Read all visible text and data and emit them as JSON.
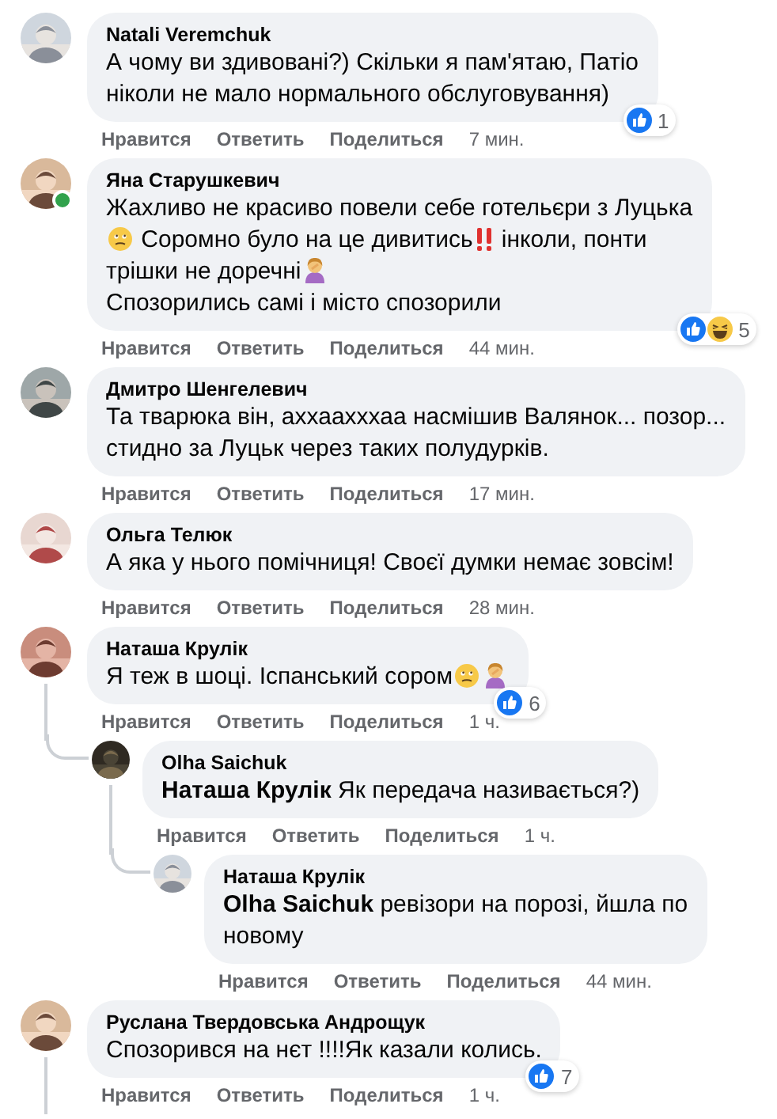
{
  "comments": [
    {
      "name": "Natali Veremchuk",
      "online": false,
      "has_replies": false,
      "body": [
        {
          "kind": "text",
          "text": "А чому ви здивовані?) Скільки я пам'ятаю, Патіо\nніколи не мало нормального обслуговування)"
        }
      ],
      "reactions": {
        "icons": [
          {
            "kind": "like"
          }
        ],
        "count": "1"
      },
      "actions": [
        "Нравится",
        "Ответить",
        "Поделиться"
      ],
      "time": "7 мин."
    },
    {
      "name": "Яна Старушкевич",
      "online": true,
      "has_replies": false,
      "body": [
        {
          "kind": "text",
          "text": "Жахливо не красиво повели себе готельєри з Луцька"
        },
        {
          "kind": "break"
        },
        {
          "kind": "face"
        },
        {
          "kind": "text",
          "text": " Соромно було на це дивитись"
        },
        {
          "kind": "bangs"
        },
        {
          "kind": "text",
          "text": " інколи, понти"
        },
        {
          "kind": "break"
        },
        {
          "kind": "text",
          "text": "трішки не доречні"
        },
        {
          "kind": "person"
        },
        {
          "kind": "break"
        },
        {
          "kind": "text",
          "text": "Спозорились самі і місто спозорили"
        }
      ],
      "reactions": {
        "icons": [
          {
            "kind": "like"
          },
          {
            "kind": "haha"
          }
        ],
        "count": "5"
      },
      "actions": [
        "Нравится",
        "Ответить",
        "Поделиться"
      ],
      "time": "44 мин."
    },
    {
      "name": "Дмитро Шенгелевич",
      "online": false,
      "has_replies": false,
      "body": [
        {
          "kind": "text",
          "text": "Та тварюка він, аххаахххаа насмішив Валянок... позор...\nстидно за Луцьк через таких полудурків."
        }
      ],
      "actions": [
        "Нравится",
        "Ответить",
        "Поделиться"
      ],
      "time": "17 мин."
    },
    {
      "name": "Ольга Телюк",
      "online": false,
      "has_replies": false,
      "body": [
        {
          "kind": "text",
          "text": "А яка у нього помічниця! Своєї думки немає зовсім!"
        }
      ],
      "actions": [
        "Нравится",
        "Ответить",
        "Поделиться"
      ],
      "time": "28 мин."
    },
    {
      "name": "Наташа Крулік",
      "online": false,
      "has_replies": true,
      "body": [
        {
          "kind": "text",
          "text": "Я теж в шоці. Іспанський сором"
        },
        {
          "kind": "face"
        },
        {
          "kind": "person"
        }
      ],
      "reactions": {
        "icons": [
          {
            "kind": "like"
          }
        ],
        "count": "6"
      },
      "actions": [
        "Нравится",
        "Ответить",
        "Поделиться"
      ],
      "time": "1 ч.",
      "replies": [
        {
          "name": "Olha Saichuk",
          "online": false,
          "has_replies": true,
          "body": [
            {
              "kind": "text",
              "text": "**Наташа Крулік** Як передача називається?)"
            }
          ],
          "actions": [
            "Нравится",
            "Ответить",
            "Поделиться"
          ],
          "time": "1 ч.",
          "replies": [
            {
              "name": "Наташа Крулік",
              "online": false,
              "has_replies": false,
              "body": [
                {
                  "kind": "text",
                  "text": "**Olha Saichuk** ревізори на порозі, йшла по\nновому"
                }
              ],
              "actions": [
                "Нравится",
                "Ответить",
                "Поделиться"
              ],
              "time": "44 мин."
            }
          ]
        }
      ]
    },
    {
      "name": "Руслана Твердовська Андрощук",
      "online": false,
      "has_replies": true,
      "body": [
        {
          "kind": "text",
          "text": "Спозорився на нєт !!!!Як казали колись."
        }
      ],
      "reactions": {
        "icons": [
          {
            "kind": "like"
          }
        ],
        "count": "7"
      },
      "actions": [
        "Нравится",
        "Ответить",
        "Поделиться"
      ],
      "time": "1 ч."
    }
  ]
}
